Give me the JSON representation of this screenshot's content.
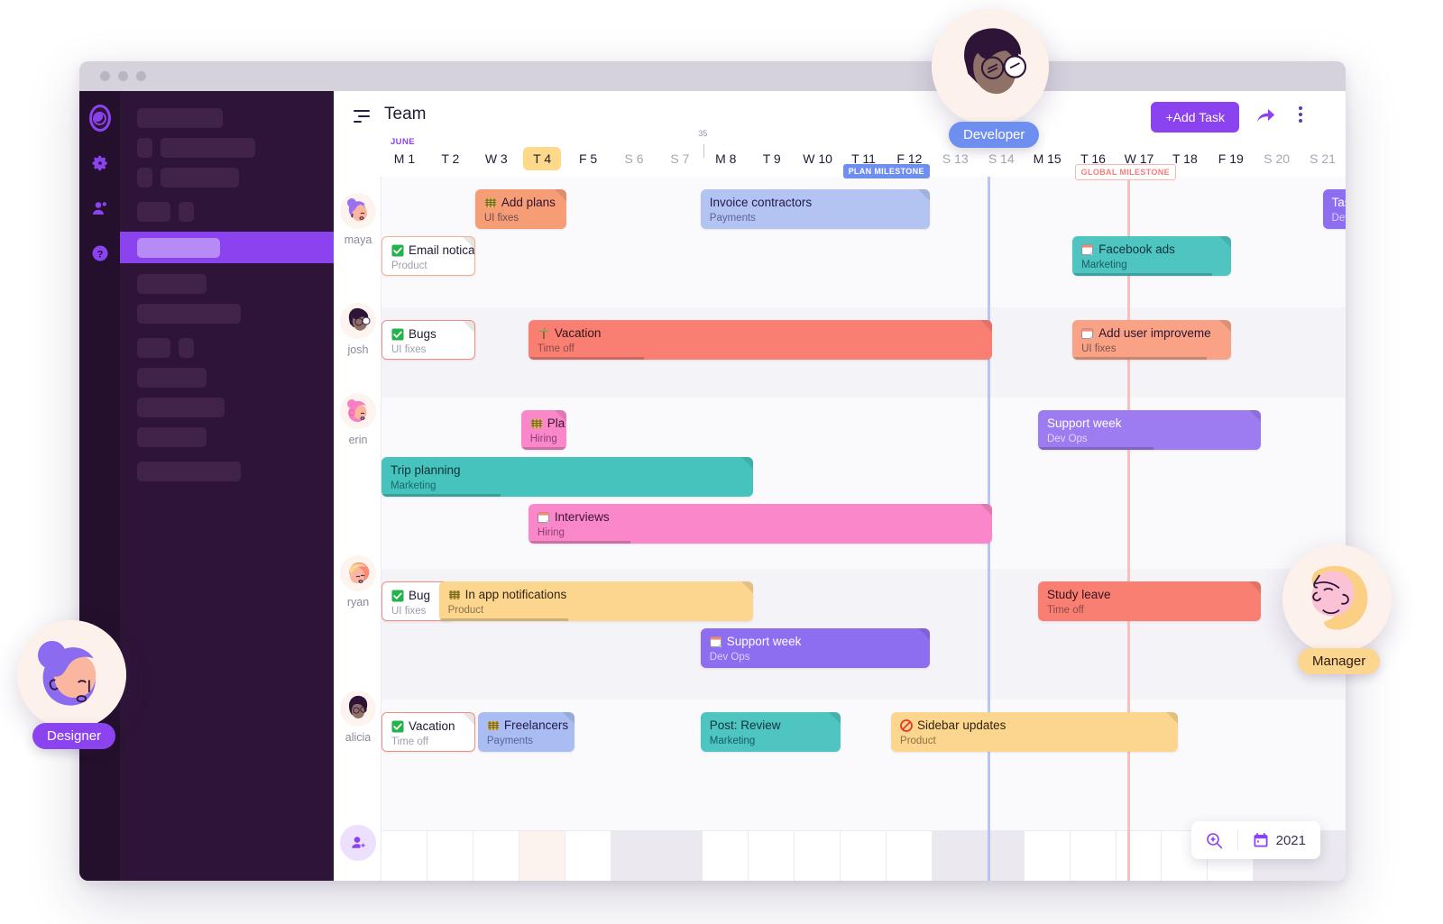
{
  "window": {
    "dots": [
      "close",
      "minimize",
      "maximize"
    ]
  },
  "sidebar": {
    "rail_icons": [
      "app-logo-icon",
      "gear-icon",
      "people-icon",
      "help-icon"
    ],
    "skeleton_rows": 11
  },
  "header": {
    "menu_icon": "filter-lines-icon",
    "title": "Team",
    "add_task_label": "+Add Task",
    "share_icon": "share-arrow-icon",
    "more_icon": "kebab-menu-icon"
  },
  "timeline": {
    "month_label": "JUNE",
    "week_number": "35",
    "days": [
      {
        "label": "M 1",
        "weekend": false,
        "today": false
      },
      {
        "label": "T 2",
        "weekend": false,
        "today": false
      },
      {
        "label": "W 3",
        "weekend": false,
        "today": false
      },
      {
        "label": "T 4",
        "weekend": false,
        "today": true
      },
      {
        "label": "F 5",
        "weekend": false,
        "today": false
      },
      {
        "label": "S 6",
        "weekend": true,
        "today": false
      },
      {
        "label": "S 7",
        "weekend": true,
        "today": false
      },
      {
        "label": "M 8",
        "weekend": false,
        "today": false
      },
      {
        "label": "T 9",
        "weekend": false,
        "today": false
      },
      {
        "label": "W 10",
        "weekend": false,
        "today": false
      },
      {
        "label": "T 11",
        "weekend": false,
        "today": false
      },
      {
        "label": "F 12",
        "weekend": false,
        "today": false
      },
      {
        "label": "S 13",
        "weekend": true,
        "today": false
      },
      {
        "label": "S 14",
        "weekend": true,
        "today": false
      },
      {
        "label": "M 15",
        "weekend": false,
        "today": false
      },
      {
        "label": "T 16",
        "weekend": false,
        "today": false
      },
      {
        "label": "W 17",
        "weekend": false,
        "today": false
      },
      {
        "label": "T 18",
        "weekend": false,
        "today": false
      },
      {
        "label": "F 19",
        "weekend": false,
        "today": false
      },
      {
        "label": "S 20",
        "weekend": true,
        "today": false
      },
      {
        "label": "S 21",
        "weekend": true,
        "today": false
      }
    ],
    "milestones": [
      {
        "label": "PLAN MILESTONE",
        "style": "plan",
        "day": 10.05
      },
      {
        "label": "GLOBAL MILESTONE",
        "style": "global",
        "day": 15.1
      }
    ],
    "today_marker_day": 13.2,
    "milestone_line_day": 16.25
  },
  "people": [
    {
      "name": "maya",
      "avatar": "avatar-maya"
    },
    {
      "name": "josh",
      "avatar": "avatar-josh"
    },
    {
      "name": "erin",
      "avatar": "avatar-erin"
    },
    {
      "name": "ryan",
      "avatar": "avatar-ryan"
    },
    {
      "name": "alicia",
      "avatar": "avatar-alicia"
    }
  ],
  "tasks": [
    {
      "title": "Add plans",
      "subtitle": "UI fixes",
      "icon": "abacus-icon",
      "color": "b-orange",
      "row": 0,
      "lane": 0,
      "start": 2.04,
      "end": 4.02,
      "progress": 0
    },
    {
      "title": "Email notica",
      "subtitle": "Product",
      "icon": "check-icon",
      "color": "b-white",
      "row": 0,
      "lane": 1,
      "start": 0.0,
      "end": 2.05,
      "progress": 0
    },
    {
      "title": "Invoice contractors",
      "subtitle": "Payments",
      "icon": "",
      "color": "b-blue",
      "row": 0,
      "lane": 0,
      "start": 6.95,
      "end": 11.95,
      "progress": 0
    },
    {
      "title": "Facebook ads",
      "subtitle": "Marketing",
      "icon": "note-icon",
      "color": "b-teal",
      "row": 0,
      "lane": 1,
      "start": 15.05,
      "end": 18.5,
      "progress": 88
    },
    {
      "title": "Task n",
      "subtitle": "Dev Op",
      "icon": "",
      "color": "b-purple2",
      "row": 0,
      "lane": 0,
      "start": 20.5,
      "end": 22.2,
      "progress": 0
    },
    {
      "title": "Bugs",
      "subtitle": "UI fixes",
      "icon": "check-icon",
      "color": "b-white2",
      "row": 1,
      "lane": 0,
      "start": 0.0,
      "end": 2.05,
      "progress": 0
    },
    {
      "title": "Vacation",
      "subtitle": "Time off",
      "icon": "palm-icon",
      "color": "b-red",
      "row": 1,
      "lane": 0,
      "start": 3.2,
      "end": 13.3,
      "progress": 25
    },
    {
      "title": "Add user improveme",
      "subtitle": "UI fixes",
      "icon": "note-icon",
      "color": "b-salmon",
      "row": 1,
      "lane": 0,
      "start": 15.05,
      "end": 18.5,
      "progress": 85
    },
    {
      "title": "Pla",
      "subtitle": "Hiring",
      "icon": "abacus-icon",
      "color": "b-pink",
      "row": 2,
      "lane": 0,
      "start": 3.04,
      "end": 4.02,
      "progress": 100
    },
    {
      "title": "Trip planning",
      "subtitle": "Marketing",
      "icon": "",
      "color": "b-teal2",
      "row": 2,
      "lane": 1,
      "start": 0.0,
      "end": 8.1,
      "progress": 32
    },
    {
      "title": "Interviews",
      "subtitle": "Hiring",
      "icon": "note-icon",
      "color": "b-pink2",
      "row": 2,
      "lane": 2,
      "start": 3.2,
      "end": 13.3,
      "progress": 22
    },
    {
      "title": "Support week",
      "subtitle": "Dev Ops",
      "icon": "",
      "color": "b-purple",
      "row": 2,
      "lane": 0,
      "start": 14.3,
      "end": 19.15,
      "progress": 52
    },
    {
      "title": "Bug",
      "subtitle": "UI fixes",
      "icon": "check-icon",
      "color": "b-white2",
      "row": 3,
      "lane": 0,
      "start": 0.0,
      "end": 1.6,
      "progress": 0
    },
    {
      "title": "In app notifications",
      "subtitle": "Product",
      "icon": "abacus-icon",
      "color": "b-yellow",
      "row": 3,
      "lane": 0,
      "start": 1.25,
      "end": 8.1,
      "progress": 41
    },
    {
      "title": "Support week",
      "subtitle": "Dev Ops",
      "icon": "note-icon",
      "color": "b-purple2",
      "row": 3,
      "lane": 1,
      "start": 6.95,
      "end": 11.95,
      "progress": 0
    },
    {
      "title": "Study leave",
      "subtitle": "Time off",
      "icon": "",
      "color": "b-red",
      "row": 3,
      "lane": 0,
      "start": 14.3,
      "end": 19.15,
      "progress": 0
    },
    {
      "title": "Vacation",
      "subtitle": "Time off",
      "icon": "check-icon",
      "color": "b-white2",
      "row": 4,
      "lane": 0,
      "start": 0.0,
      "end": 2.05,
      "progress": 0
    },
    {
      "title": "Freelancers",
      "subtitle": "Payments",
      "icon": "abacus-icon",
      "color": "b-blue2",
      "row": 4,
      "lane": 0,
      "start": 2.1,
      "end": 4.2,
      "progress": 0
    },
    {
      "title": "Post: Review",
      "subtitle": "Marketing",
      "icon": "",
      "color": "b-teal",
      "row": 4,
      "lane": 0,
      "start": 6.95,
      "end": 10.0,
      "progress": 0
    },
    {
      "title": "Sidebar updates",
      "subtitle": "Product",
      "icon": "blocked-icon",
      "color": "b-yellow",
      "row": 4,
      "lane": 0,
      "start": 11.1,
      "end": 17.35,
      "progress": 0
    }
  ],
  "footer": {
    "add_person_icon": "add-person-icon",
    "zoom_icon": "zoom-in-icon",
    "calendar_icon": "calendar-icon",
    "year": "2021"
  },
  "floating_roles": [
    {
      "label": "Developer",
      "style": "dev"
    },
    {
      "label": "Designer",
      "style": "des"
    },
    {
      "label": "Manager",
      "style": "man"
    }
  ],
  "colors": {
    "accent": "#8b43f0",
    "today": "#ffd98a",
    "developer": "#6f8ff0",
    "designer": "#8b43f0",
    "manager": "#fcd68e"
  }
}
